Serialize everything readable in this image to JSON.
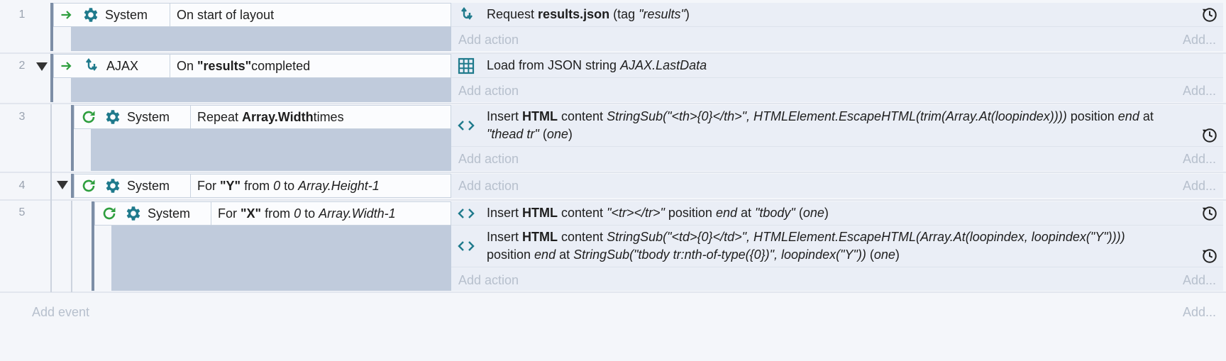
{
  "colors": {
    "accent": "#1f7a8c",
    "green": "#2e9e3e",
    "condition_fill": "#c0cbdc",
    "muted": "#b7c0cd"
  },
  "events": [
    {
      "number": "1",
      "arrow": "→",
      "object": "System",
      "condition": "On start of layout",
      "actions": [
        {
          "parts": [
            "Request ",
            "results.json",
            " (tag ",
            "\"results\"",
            ")"
          ]
        }
      ]
    },
    {
      "number": "2",
      "arrow": "→",
      "object": "AJAX",
      "condition": [
        "On ",
        "\"results\"",
        " completed"
      ],
      "actions": [
        {
          "parts": [
            "Load from JSON string ",
            "AJAX.LastData"
          ]
        }
      ]
    },
    {
      "number": "3",
      "object": "System",
      "condition": [
        "Repeat ",
        "Array.Width",
        " times"
      ],
      "actions": [
        {
          "parts": [
            "Insert ",
            "HTML",
            " content ",
            "StringSub(\"<th>{0}</th>\", HTMLElement.EscapeHTML(trim(Array.At(loopindex))))",
            " position ",
            "end",
            " at",
            "\"thead tr\"",
            " (",
            "one",
            ")"
          ]
        }
      ]
    },
    {
      "number": "4",
      "object": "System",
      "condition": [
        "For ",
        "\"Y\"",
        " from ",
        "0",
        " to ",
        "Array.Height-1"
      ],
      "actions": []
    },
    {
      "number": "5",
      "object": "System",
      "condition": [
        "For ",
        "\"X\"",
        " from ",
        "0",
        " to ",
        "Array.Width-1"
      ],
      "actions": [
        {
          "parts": [
            "Insert ",
            "HTML",
            " content ",
            "\"<tr></tr>\"",
            " position ",
            "end",
            " at ",
            "\"tbody\"",
            " (",
            "one",
            ")"
          ]
        },
        {
          "parts": [
            "Insert ",
            "HTML",
            " content ",
            "StringSub(\"<td>{0}</td>\", HTMLElement.EscapeHTML(Array.At(loopindex, loopindex(\"Y\"))))",
            "position ",
            "end",
            " at ",
            "StringSub(\"tbody tr:nth-of-type({0})\", loopindex(\"Y\"))",
            " (",
            "one",
            ")"
          ]
        }
      ]
    }
  ],
  "labels": {
    "add_action": "Add action",
    "add_more": "Add...",
    "add_event": "Add event"
  },
  "icons": {
    "trigger": "arrow-right-icon",
    "loop": "loop-icon",
    "system": "gear-icon",
    "ajax": "ajax-icon",
    "array": "grid-icon",
    "html": "code-brackets-icon",
    "wait": "clock-icon"
  }
}
